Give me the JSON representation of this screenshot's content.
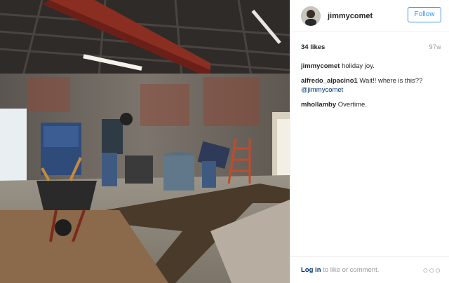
{
  "post": {
    "username": "jimmycomet",
    "follow_label": "Follow",
    "likes": "34 likes",
    "age": "97w",
    "comments": [
      {
        "user": "jimmycomet",
        "text": "holiday joy."
      },
      {
        "user": "alfredo_alpacino1",
        "text": "Wait!! where is this??",
        "mention": "@jimmycomet"
      },
      {
        "user": "mhollamby",
        "text": "Overtime."
      }
    ],
    "footer": {
      "login_link": "Log in",
      "login_text": " to like or comment.",
      "more_icon": "ellipsis-icon",
      "more_glyph": "○○○"
    }
  },
  "colors": {
    "accent": "#3897f0",
    "link": "#003569",
    "muted": "#999999",
    "text": "#262626"
  },
  "icons": {
    "avatar": "avatar-image",
    "photo": "construction-site-photo"
  }
}
